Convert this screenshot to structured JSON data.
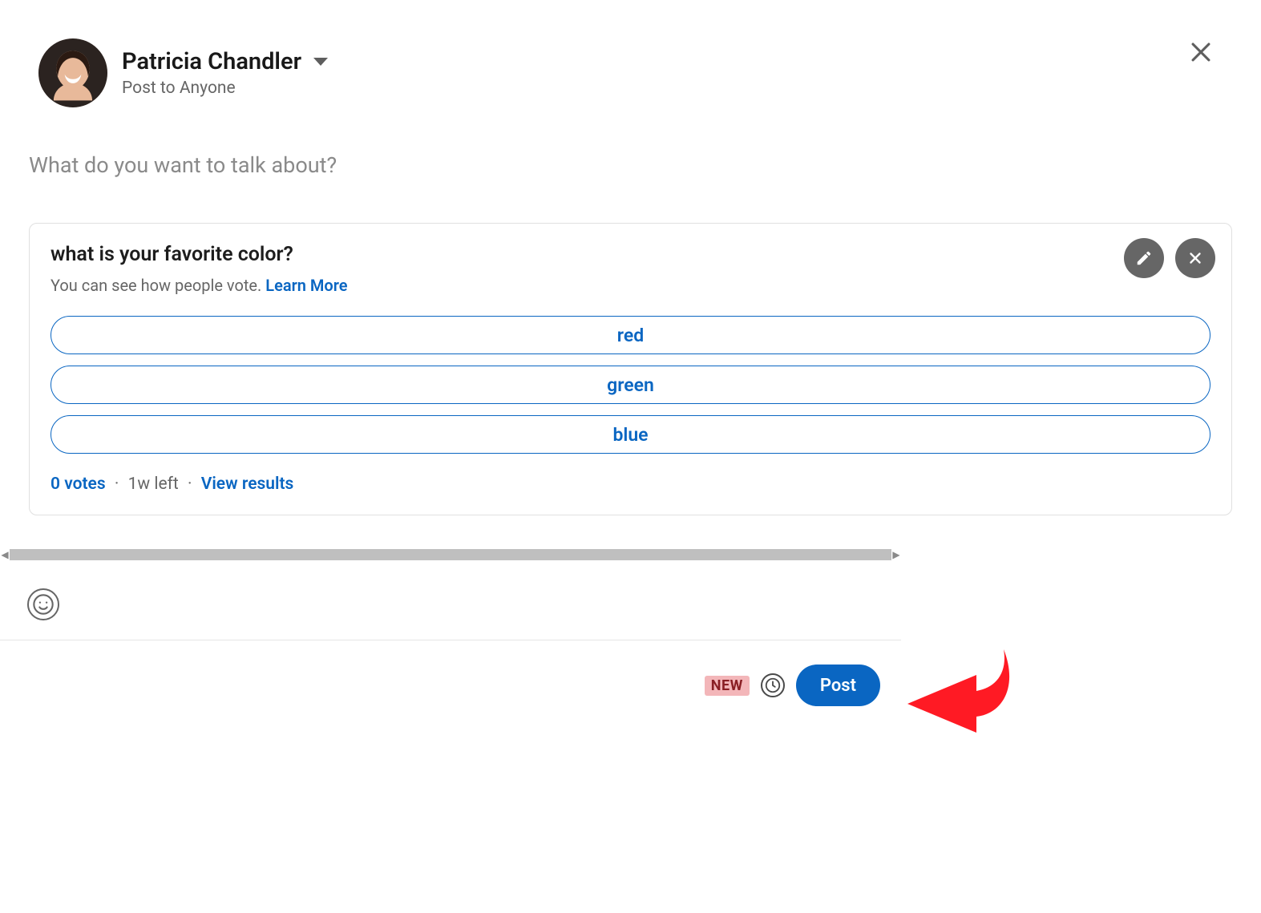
{
  "header": {
    "user_name": "Patricia Chandler",
    "visibility": "Post to Anyone"
  },
  "composer": {
    "placeholder": "What do you want to talk about?"
  },
  "poll": {
    "question": "what is your favorite color?",
    "subtext": "You can see how people vote. ",
    "learn_more": "Learn More",
    "options": [
      "red",
      "green",
      "blue"
    ],
    "votes_label": "0 votes",
    "time_left": "1w left",
    "view_results": "View results"
  },
  "footer": {
    "new_badge": "NEW",
    "post_label": "Post"
  }
}
